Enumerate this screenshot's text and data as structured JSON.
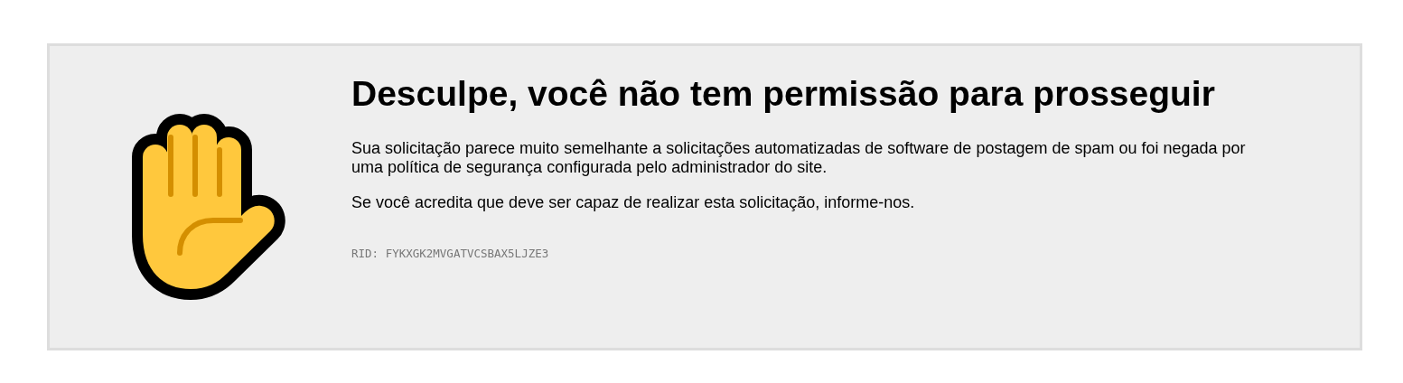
{
  "notice": {
    "title": "Desculpe, você não tem permissão para prosseguir",
    "paragraphs": [
      "Sua solicitação parece muito semelhante a solicitações automatizadas de software de postagem de spam ou foi negada por uma política de segurança configurada pelo administrador do site.",
      "Se você acredita que deve ser capaz de realizar esta solicitação, informe-nos."
    ],
    "rid": "RID: FYKXGK2MVGATVCSBAX5LJZE3"
  }
}
